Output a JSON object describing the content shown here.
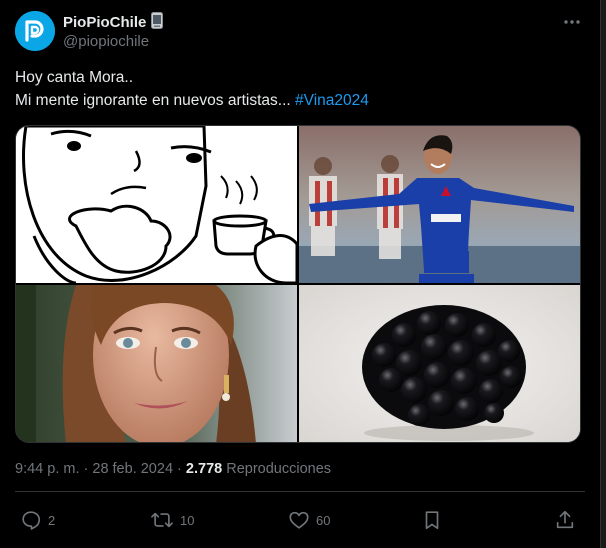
{
  "author": {
    "display_name": "PioPioChile",
    "handle": "@piopiochile",
    "avatar_icon": "piopio-logo-icon",
    "badge_icon": "mobile-phone-badge-icon"
  },
  "tweet": {
    "line1": "Hoy canta Mora..",
    "line2_text": "Mi mente ignorante en nuevos artistas... ",
    "hashtag": "#Vina2024"
  },
  "media": [
    {
      "description": "thinking-meme-with-coffee"
    },
    {
      "description": "football-player-celebrating"
    },
    {
      "description": "woman-selfie-portrait"
    },
    {
      "description": "blackberry-fruit"
    }
  ],
  "meta": {
    "time": "9:44 p. m.",
    "separator": " · ",
    "date": "28 feb. 2024",
    "views_count": "2.778",
    "views_label": " Reproducciones"
  },
  "actions": {
    "replies": "2",
    "retweets": "10",
    "likes": "60"
  },
  "colors": {
    "background": "#000000",
    "text": "#e7e9ea",
    "secondary": "#71767b",
    "accent": "#1d9bf0",
    "border": "#2f3336"
  }
}
